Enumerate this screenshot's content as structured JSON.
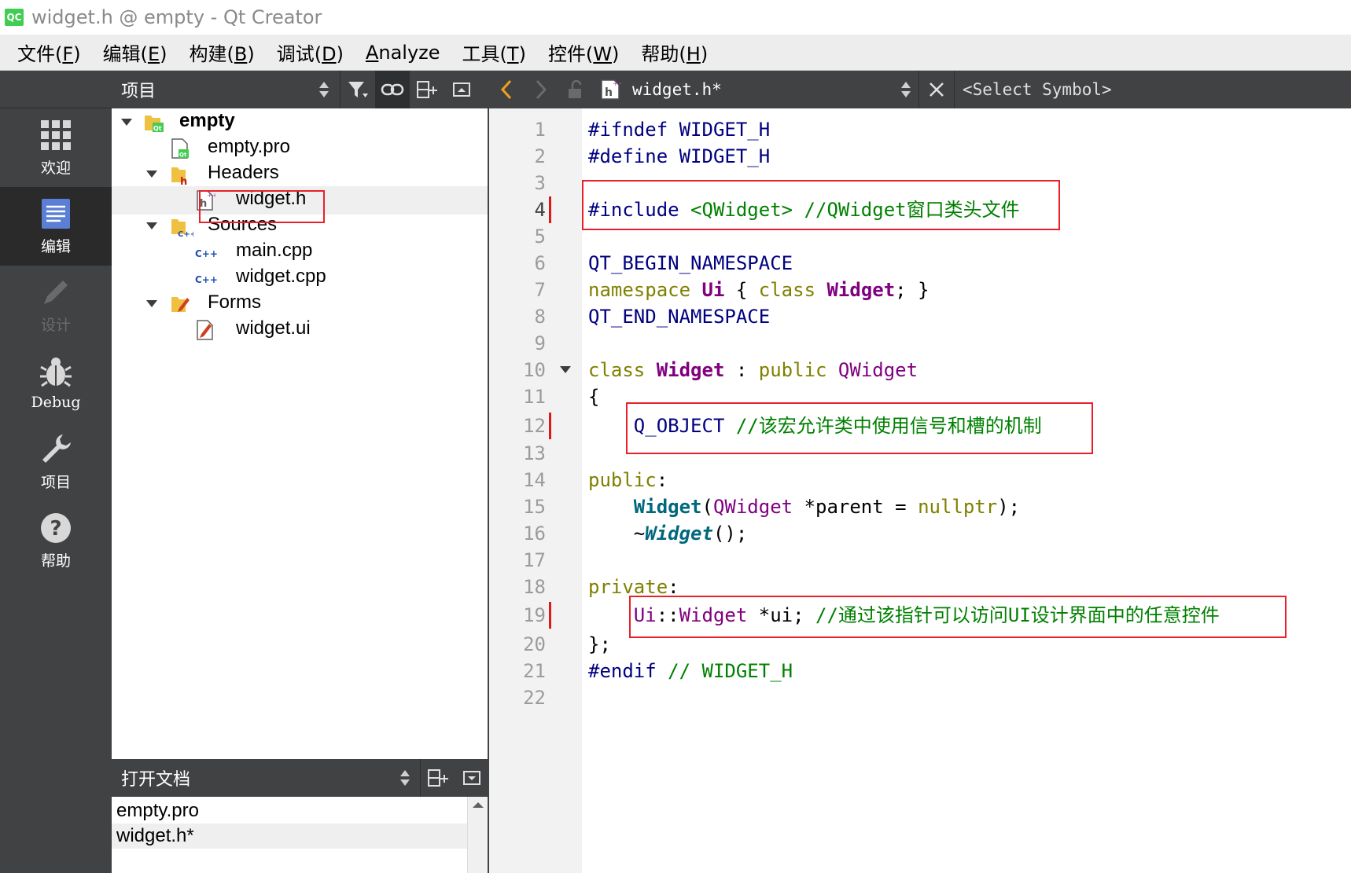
{
  "window": {
    "logo": "QC",
    "title": "widget.h @ empty - Qt Creator"
  },
  "menu": [
    {
      "label": "文件(",
      "key": "F",
      "tail": ")"
    },
    {
      "label": "编辑(",
      "key": "E",
      "tail": ")"
    },
    {
      "label": "构建(",
      "key": "B",
      "tail": ")"
    },
    {
      "label": "调试(",
      "key": "D",
      "tail": ")"
    },
    {
      "label": "",
      "key": "A",
      "tail": "nalyze"
    },
    {
      "label": "工具(",
      "key": "T",
      "tail": ")"
    },
    {
      "label": "控件(",
      "key": "W",
      "tail": ")"
    },
    {
      "label": "帮助(",
      "key": "H",
      "tail": ")"
    }
  ],
  "modes": [
    {
      "label": "欢迎",
      "icon": "grid-icon",
      "state": "normal"
    },
    {
      "label": "编辑",
      "icon": "document-icon",
      "state": "active"
    },
    {
      "label": "设计",
      "icon": "pencil-icon",
      "state": "disabled"
    },
    {
      "label": "Debug",
      "icon": "bug-icon",
      "state": "normal"
    },
    {
      "label": "项目",
      "icon": "wrench-icon",
      "state": "normal"
    },
    {
      "label": "帮助",
      "icon": "help-icon",
      "state": "normal"
    }
  ],
  "project_pane": {
    "title": "项目",
    "tree": [
      {
        "name": "empty",
        "icon": "qt-project-folder-icon",
        "expanded": true,
        "depth": 0,
        "bold": true
      },
      {
        "name": "empty.pro",
        "icon": "pro-file-icon",
        "depth": 1
      },
      {
        "name": "Headers",
        "icon": "headers-folder-icon",
        "expanded": true,
        "depth": 1
      },
      {
        "name": "widget.h",
        "icon": "header-file-icon",
        "depth": 2,
        "selected": true
      },
      {
        "name": "Sources",
        "icon": "sources-folder-icon",
        "expanded": true,
        "depth": 1
      },
      {
        "name": "main.cpp",
        "icon": "cpp-file-icon",
        "depth": 2
      },
      {
        "name": "widget.cpp",
        "icon": "cpp-file-icon",
        "depth": 2
      },
      {
        "name": "Forms",
        "icon": "forms-folder-icon",
        "expanded": true,
        "depth": 1
      },
      {
        "name": "widget.ui",
        "icon": "ui-file-icon",
        "depth": 2
      }
    ]
  },
  "open_docs": {
    "title": "打开文档",
    "items": [
      {
        "name": "empty.pro",
        "selected": false
      },
      {
        "name": "widget.h*",
        "selected": true
      }
    ]
  },
  "editor": {
    "filename": "widget.h*",
    "symbol": "<Select Symbol>",
    "current_line": 4,
    "lines": [
      {
        "n": "1",
        "segs": [
          {
            "c": "pp",
            "t": "#ifndef WIDGET_H"
          }
        ]
      },
      {
        "n": "2",
        "segs": [
          {
            "c": "pp",
            "t": "#define WIDGET_H"
          }
        ]
      },
      {
        "n": "3",
        "segs": []
      },
      {
        "n": "4",
        "segs": [
          {
            "c": "pp",
            "t": "#include "
          },
          {
            "c": "str",
            "t": "<QWidget>"
          },
          {
            "c": "cm",
            "t": " //QWidget窗口类头文件"
          }
        ],
        "mark": true
      },
      {
        "n": "5",
        "segs": []
      },
      {
        "n": "6",
        "segs": [
          {
            "c": "qt",
            "t": "QT_BEGIN_NAMESPACE"
          }
        ]
      },
      {
        "n": "7",
        "segs": [
          {
            "c": "kw",
            "t": "namespace "
          },
          {
            "c": "type",
            "t": "Ui"
          },
          {
            "c": "",
            "t": " { "
          },
          {
            "c": "kw",
            "t": "class "
          },
          {
            "c": "type",
            "t": "Widget"
          },
          {
            "c": "",
            "t": "; }"
          }
        ]
      },
      {
        "n": "8",
        "segs": [
          {
            "c": "qt",
            "t": "QT_END_NAMESPACE"
          }
        ]
      },
      {
        "n": "9",
        "segs": []
      },
      {
        "n": "10",
        "segs": [
          {
            "c": "kw",
            "t": "class "
          },
          {
            "c": "type",
            "t": "Widget"
          },
          {
            "c": "",
            "t": " : "
          },
          {
            "c": "kw",
            "t": "public "
          },
          {
            "c": "cls",
            "t": "QWidget"
          }
        ],
        "fold": true
      },
      {
        "n": "11",
        "segs": [
          {
            "c": "",
            "t": "{"
          }
        ]
      },
      {
        "n": "12",
        "segs": [
          {
            "c": "",
            "t": "    "
          },
          {
            "c": "qt",
            "t": "Q_OBJECT"
          },
          {
            "c": "cm",
            "t": " //该宏允许类中使用信号和槽的机制"
          }
        ],
        "mark": true
      },
      {
        "n": "13",
        "segs": []
      },
      {
        "n": "14",
        "segs": [
          {
            "c": "kw",
            "t": "public"
          },
          {
            "c": "",
            "t": ":"
          }
        ]
      },
      {
        "n": "15",
        "segs": [
          {
            "c": "",
            "t": "    "
          },
          {
            "c": "fn",
            "t": "Widget"
          },
          {
            "c": "",
            "t": "("
          },
          {
            "c": "cls",
            "t": "QWidget"
          },
          {
            "c": "",
            "t": " *parent = "
          },
          {
            "c": "kw",
            "t": "nullptr"
          },
          {
            "c": "",
            "t": ");"
          }
        ]
      },
      {
        "n": "16",
        "segs": [
          {
            "c": "",
            "t": "    ~"
          },
          {
            "c": "fni",
            "t": "Widget"
          },
          {
            "c": "",
            "t": "();"
          }
        ]
      },
      {
        "n": "17",
        "segs": []
      },
      {
        "n": "18",
        "segs": [
          {
            "c": "kw",
            "t": "private"
          },
          {
            "c": "",
            "t": ":"
          }
        ]
      },
      {
        "n": "19",
        "segs": [
          {
            "c": "",
            "t": "    "
          },
          {
            "c": "cls",
            "t": "Ui"
          },
          {
            "c": "",
            "t": "::"
          },
          {
            "c": "cls",
            "t": "Widget"
          },
          {
            "c": "",
            "t": " *ui; "
          },
          {
            "c": "cm",
            "t": "//通过该指针可以访问UI设计界面中的任意控件"
          }
        ],
        "mark": true
      },
      {
        "n": "20",
        "segs": [
          {
            "c": "",
            "t": "};"
          }
        ]
      },
      {
        "n": "21",
        "segs": [
          {
            "c": "pp",
            "t": "#endif "
          },
          {
            "c": "cm",
            "t": "// WIDGET_H"
          }
        ]
      },
      {
        "n": "22",
        "segs": []
      }
    ]
  },
  "colors": {
    "annotation_box": "#e8202a",
    "modebar_bg": "#404244",
    "active_mode_bg": "#2a2a2a"
  }
}
